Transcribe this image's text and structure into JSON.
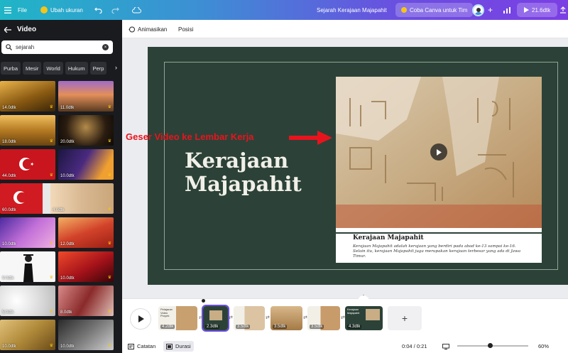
{
  "topbar": {
    "menu_icon": "hamburger-icon",
    "file_label": "File",
    "resize_label": "Ubah ukuran",
    "undo_icon": "undo-icon",
    "redo_icon": "redo-icon",
    "cloud_icon": "cloud-sync-icon",
    "doc_title": "Sejarah Kerajaan Majapahit",
    "try_team_label": "Coba Canva untuk Tim",
    "chart_icon": "bar-chart-icon",
    "play_duration": "21.6dtk",
    "share_icon": "upload-icon",
    "accent_colors": [
      "#20b5c7",
      "#7b3fe4"
    ]
  },
  "leftpanel": {
    "title": "Video",
    "back_icon": "arrow-left-icon",
    "search": {
      "value": "sejarah",
      "icon": "search-icon",
      "clear_icon": "clear-icon"
    },
    "chips": [
      "Purba",
      "Mesir",
      "World",
      "Hukum",
      "Perp"
    ],
    "chip_next_icon": "chevron-right-icon",
    "videos": [
      {
        "duration": "14.0dtk",
        "crown": true
      },
      {
        "duration": "11.0dtk",
        "crown": true
      },
      {
        "duration": "18.0dtk",
        "crown": true
      },
      {
        "duration": "20.0dtk",
        "crown": true
      },
      {
        "duration": "44.0dtk",
        "crown": true
      },
      {
        "duration": "10.0dtk",
        "crown": true
      },
      {
        "duration": "60.0dtk",
        "crown": false
      },
      {
        "duration": "4.0dtk",
        "crown": true
      },
      {
        "duration": "10.0dtk",
        "crown": true
      },
      {
        "duration": "12.0dtk",
        "crown": true
      },
      {
        "duration": "9.0dtk",
        "crown": true
      },
      {
        "duration": "10.0dtk",
        "crown": true
      },
      {
        "duration": "5.0dtk",
        "crown": true
      },
      {
        "duration": "8.0dtk",
        "crown": true
      },
      {
        "duration": "10.0dtk",
        "crown": true
      },
      {
        "duration": "10.0dtk",
        "crown": true
      }
    ]
  },
  "toolbar": {
    "animate_label": "Animasikan",
    "position_label": "Posisi"
  },
  "slide": {
    "title": "Kerajaan Majapahit",
    "annotation": "Geser Video ke Lembar Kerja",
    "caption_title": "Kerajaan Majapahit",
    "caption_body": "Kerajaan Majapahit adalah kerajaan yang berdiri pada abad ke-13 sampai ke-16. Selain itu, kerajaan Majapahit juga merupakan kerajaan terbesar yang ada di Jawa Timur."
  },
  "timeline": {
    "clips": [
      {
        "duration": "4.2dtk",
        "thumb_text": "Pelajaran Video Proyek"
      },
      {
        "duration": "2.3dtk",
        "thumb_text": ""
      },
      {
        "duration": "3.5dtk",
        "thumb_text": ""
      },
      {
        "duration": "3.5dtk",
        "thumb_text": ""
      },
      {
        "duration": "3.5dtk",
        "thumb_text": ""
      },
      {
        "duration": "4.3dtk",
        "thumb_text": "Kerajaan Majapahit"
      }
    ],
    "add_label": "+"
  },
  "bottombar": {
    "notes_label": "Catatan",
    "duration_label": "Durasi",
    "time": "0:04 / 0:21",
    "zoom": "60%",
    "zoom_fraction": 0.45
  }
}
